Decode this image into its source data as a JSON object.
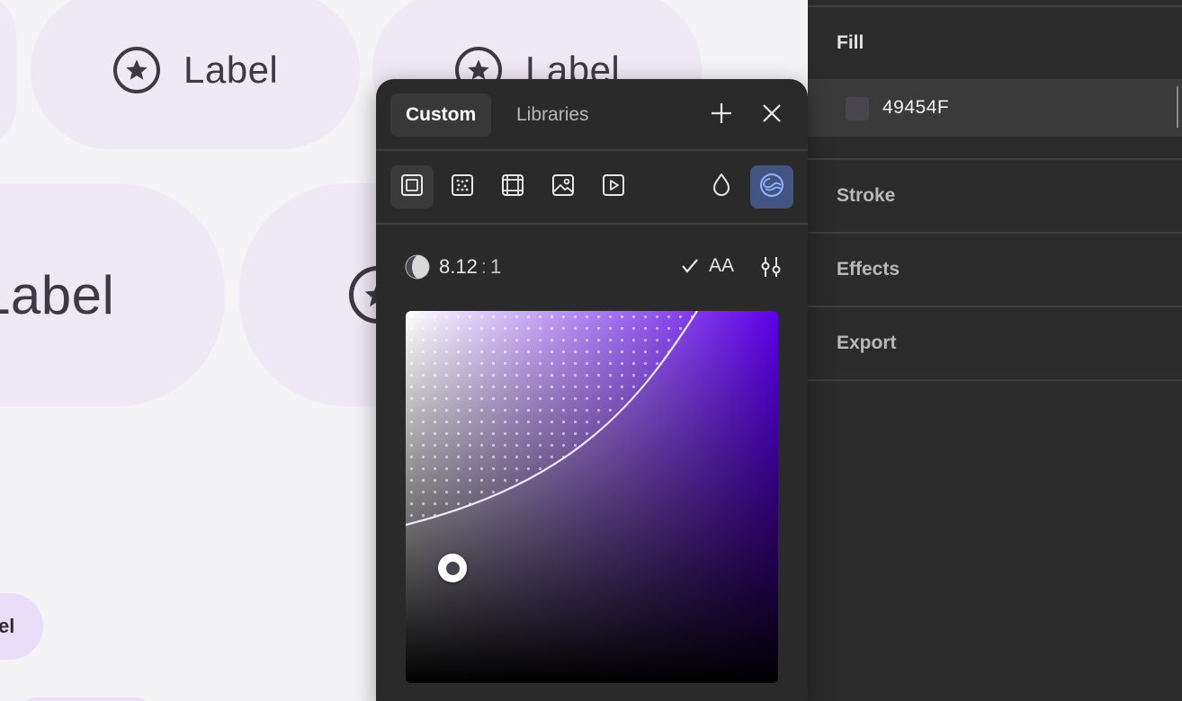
{
  "canvas": {
    "chips": [
      {
        "label": "Label"
      },
      {
        "label": "Label"
      },
      {
        "label": "Label"
      },
      {
        "label": "el"
      }
    ]
  },
  "picker": {
    "tabs": [
      {
        "label": "Custom",
        "active": true
      },
      {
        "label": "Libraries",
        "active": false
      }
    ],
    "header_icons": [
      "plus-icon",
      "close-icon"
    ],
    "tools": [
      "solid-fill-icon",
      "noise-fill-icon",
      "pattern-fill-icon",
      "image-fill-icon",
      "video-fill-icon",
      "opacity-drop-icon",
      "contrast-check-icon"
    ],
    "contrast": {
      "ratio_value": "8.12",
      "ratio_separator": ":",
      "ratio_base": "1",
      "check_label": "AA"
    },
    "colors": {
      "hue": "#5b00e8",
      "selected": "#49454F"
    }
  },
  "panel": {
    "fill_title": "Fill",
    "fill_hex": "49454F",
    "fill_color": "#49454F",
    "sections": [
      {
        "label": "Stroke"
      },
      {
        "label": "Effects"
      },
      {
        "label": "Export"
      }
    ]
  }
}
